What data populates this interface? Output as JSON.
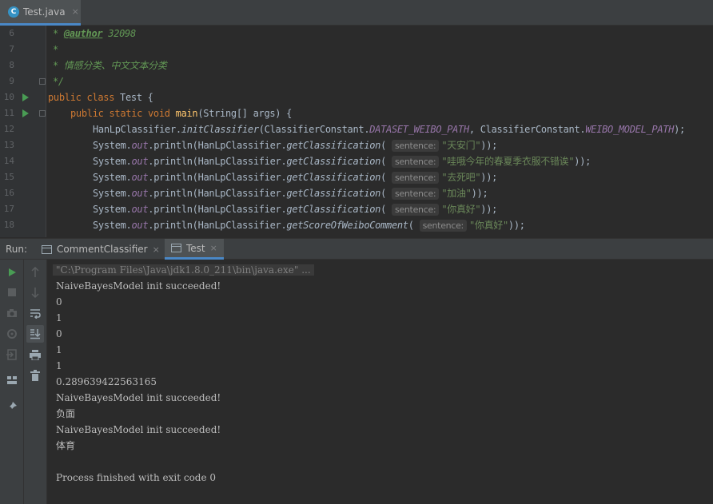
{
  "editor_tab": {
    "icon": "C",
    "label": "Test.java",
    "close": "×"
  },
  "editor": {
    "line_numbers": [
      "6",
      "7",
      "8",
      "9",
      "10",
      "11",
      "12",
      "13",
      "14",
      "15",
      "16",
      "17",
      "18"
    ],
    "comment": {
      "l6_star": "* ",
      "l6_tag": "@author",
      "l6_rest": " 32098",
      "l7": "*",
      "l8": "* 情感分类、中文文本分类",
      "l9": "*/"
    },
    "kw": {
      "public": "public",
      "class": "class",
      "static": "static",
      "void": "void"
    },
    "class_name": " Test {",
    "main": {
      "name": "main",
      "params": "(String[] args) {"
    },
    "init": {
      "obj": "HanLpClassifier.",
      "method": "initClassifier",
      "arg1_obj": "(ClassifierConstant.",
      "arg1": "DATASET_WEIBO_PATH",
      "sep": ", ClassifierConstant.",
      "arg2": "WEIBO_MODEL_PATH",
      "end": ");"
    },
    "sys": "System.",
    "out": "out",
    "println": ".println(HanLpClassifier.",
    "getClassification": "getClassification",
    "getScore": "getScoreOfWeiboComment",
    "open_paren": "(",
    "hint": "sentence:",
    "close": "));",
    "strings": [
      "\"天安门\"",
      "\"哇哦今年的春夏季衣服不错诶\"",
      "\"去死吧\"",
      "\"加油\"",
      "\"你真好\"",
      "\"你真好\""
    ]
  },
  "run_panel": {
    "label": "Run:",
    "tabs": [
      {
        "label": "CommentClassifier",
        "close": "×"
      },
      {
        "label": "Test",
        "close": "×"
      }
    ]
  },
  "console": {
    "lines": [
      "\"C:\\Program Files\\Java\\jdk1.8.0_211\\bin\\java.exe\" ...",
      "NaiveBayesModel init succeeded!",
      "0",
      "1",
      "0",
      "1",
      "1",
      "0.289639422563165",
      "NaiveBayesModel init succeeded!",
      "负面",
      "NaiveBayesModel init succeeded!",
      "体育",
      "",
      "Process finished with exit code 0"
    ]
  },
  "colors": {
    "accent": "#4a88c7",
    "run_green": "#499c54",
    "keyword": "#cc7832",
    "string": "#6a8759",
    "doc_comment": "#629755",
    "method": "#ffc66d",
    "static_field": "#9876aa"
  },
  "icons": {
    "run_toolbar": [
      "rerun-icon",
      "stop-icon",
      "snapshot-icon",
      "debug-settings-icon",
      "exit-icon",
      "layout-icon",
      "pin-icon"
    ],
    "run_toolbar2": [
      "up-arrow-icon",
      "down-arrow-icon",
      "soft-wrap-icon",
      "scroll-to-end-icon",
      "print-icon",
      "trash-icon"
    ]
  }
}
